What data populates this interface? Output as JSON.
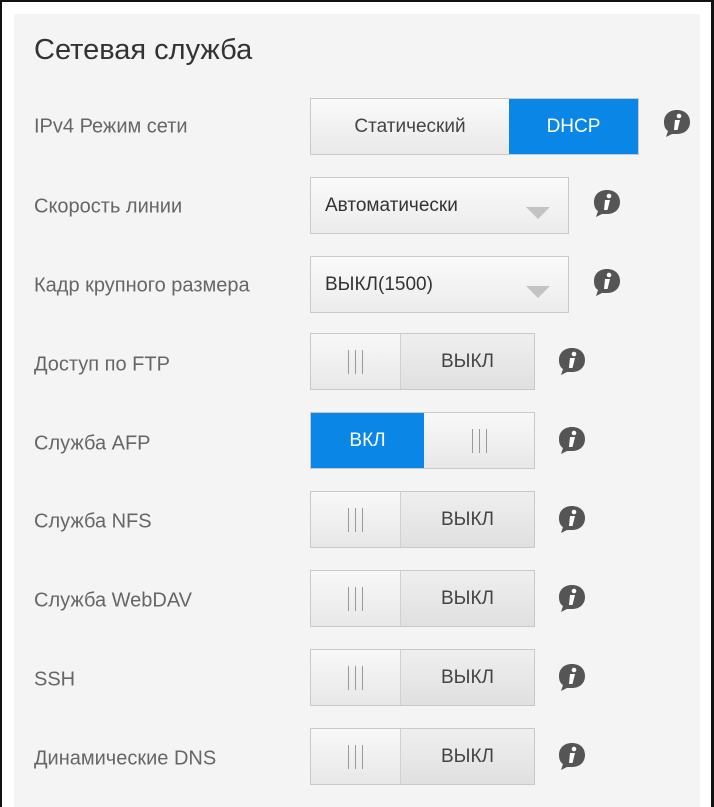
{
  "page": {
    "title": "Сетевая служба"
  },
  "colors": {
    "accent": "#0a87e6",
    "label": "#666666",
    "info_icon": "#555555"
  },
  "rows": {
    "ipv4": {
      "label": "IPv4 Режим сети",
      "options": [
        "Статический",
        "DHCP"
      ],
      "selected": "DHCP",
      "info_icon": "info-icon"
    },
    "speed": {
      "label": "Скорость линии",
      "value": "Автоматически",
      "info_icon": "info-icon"
    },
    "jumbo": {
      "label": "Кадр крупного размера",
      "value": "ВЫКЛ(1500)",
      "info_icon": "info-icon"
    },
    "ftp": {
      "label": "Доступ по FTP",
      "state": "ВЫКЛ",
      "on": false
    },
    "afp": {
      "label": "Служба AFP",
      "state": "ВКЛ",
      "on": true
    },
    "nfs": {
      "label": "Служба NFS",
      "state": "ВЫКЛ",
      "on": false
    },
    "webdav": {
      "label": "Служба WebDAV",
      "state": "ВЫКЛ",
      "on": false
    },
    "ssh": {
      "label": "SSH",
      "state": "ВЫКЛ",
      "on": false
    },
    "ddns": {
      "label": "Динамические DNS",
      "state": "ВЫКЛ",
      "on": false
    }
  }
}
